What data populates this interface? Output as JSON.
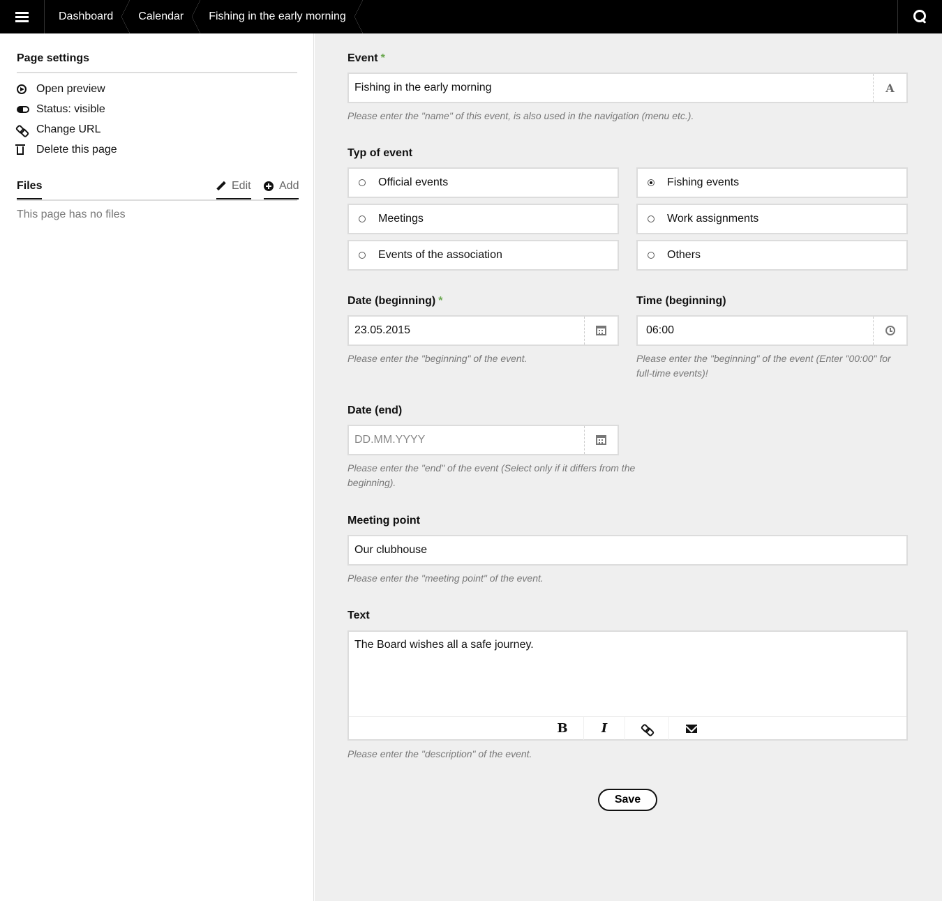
{
  "topbar": {
    "breadcrumbs": [
      "Dashboard",
      "Calendar",
      "Fishing in the early morning"
    ]
  },
  "sidebar": {
    "page_settings_title": "Page settings",
    "items": [
      {
        "label": "Open preview",
        "icon": "play-circle-icon"
      },
      {
        "label": "Status: visible",
        "icon": "toggle-icon"
      },
      {
        "label": "Change URL",
        "icon": "link-icon"
      },
      {
        "label": "Delete this page",
        "icon": "trash-icon"
      }
    ],
    "files_title": "Files",
    "edit_label": "Edit",
    "add_label": "Add",
    "no_files": "This page has no files"
  },
  "form": {
    "event": {
      "label": "Event",
      "required": "*",
      "value": "Fishing in the early morning",
      "help": "Please enter the \"name\" of this event, is also used in the navigation (menu etc.)."
    },
    "type": {
      "label": "Typ of event",
      "options": [
        {
          "label": "Official events",
          "checked": false
        },
        {
          "label": "Fishing events",
          "checked": true
        },
        {
          "label": "Meetings",
          "checked": false
        },
        {
          "label": "Work assignments",
          "checked": false
        },
        {
          "label": "Events of the association",
          "checked": false
        },
        {
          "label": "Others",
          "checked": false
        }
      ]
    },
    "date_begin": {
      "label": "Date (beginning)",
      "required": "*",
      "value": "23.05.2015",
      "help": "Please enter the \"beginning\" of the event."
    },
    "time_begin": {
      "label": "Time (beginning)",
      "value": "06:00",
      "help_line1": "Please enter the \"beginning\" of the event (Enter \"00:00\" for",
      "help_line2": "full-time events)!"
    },
    "date_end": {
      "label": "Date (end)",
      "placeholder": "DD.MM.YYYY",
      "help_line1": "Please enter the \"end\" of the event (Select only if it differs from the",
      "help_line2": "beginning)."
    },
    "meeting_point": {
      "label": "Meeting point",
      "value": "Our clubhouse",
      "help": "Please enter the \"meeting point\" of the event."
    },
    "text": {
      "label": "Text",
      "value": "The Board wishes all a safe journey.",
      "help": "Please enter the \"description\" of the event.",
      "toolbar": {
        "bold": "B",
        "italic": "I"
      }
    },
    "save_label": "Save"
  }
}
